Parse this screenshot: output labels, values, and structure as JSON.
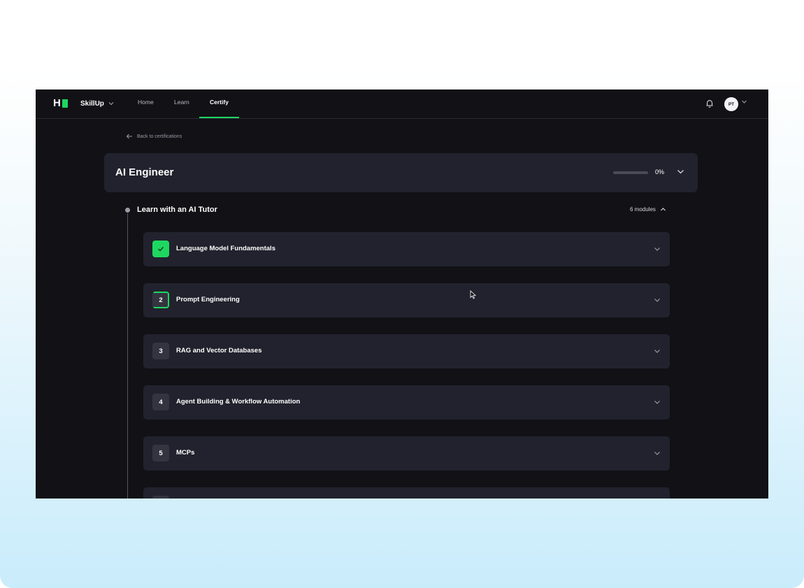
{
  "nav": {
    "product": "SkillUp",
    "links": [
      {
        "label": "Home",
        "active": false
      },
      {
        "label": "Learn",
        "active": false
      },
      {
        "label": "Certify",
        "active": true
      }
    ],
    "avatar_initials": "PT",
    "accent": "#1ed760"
  },
  "back_link": "Back to certifications",
  "certification": {
    "title": "AI Engineer",
    "progress_percent": 0,
    "progress_label": "0%"
  },
  "section": {
    "title": "Learn with an AI Tutor",
    "module_count": "6 modules"
  },
  "modules": [
    {
      "badge": "",
      "title": "Language Model Fundamentals",
      "status": "completed",
      "icon": "check-icon"
    },
    {
      "badge": "2",
      "title": "Prompt Engineering",
      "status": "in-progress"
    },
    {
      "badge": "3",
      "title": "RAG and Vector Databases",
      "status": "not-started"
    },
    {
      "badge": "4",
      "title": "Agent Building & Workflow Automation",
      "status": "not-started"
    },
    {
      "badge": "5",
      "title": "MCPs",
      "status": "not-started"
    },
    {
      "badge": "",
      "title": "",
      "status": "not-started"
    }
  ]
}
